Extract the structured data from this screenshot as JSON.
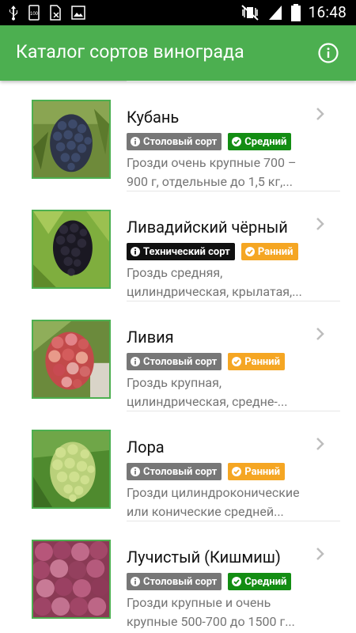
{
  "status_bar": {
    "time": "16:48",
    "left_icons": [
      "usb-icon",
      "storage-100-icon",
      "sim-off-icon",
      "image-icon"
    ],
    "right_icons": [
      "mute-vibrate-icon",
      "signal-icon",
      "battery-icon"
    ]
  },
  "app_bar": {
    "title": "Каталог сортов винограда",
    "background": "#4CAF50",
    "action_icon": "info-icon"
  },
  "items": [
    {
      "title": "Кубань",
      "tag1": "Столовый сорт",
      "tag1_color": "#777777",
      "tag2": "Средний",
      "tag2_color": "#138D13",
      "desc1": "Грозди очень крупные 700 –",
      "desc2": "900 г, отдельные до 1,5 кг,..."
    },
    {
      "title": "Ливадийский чёрный",
      "tag1": "Технический сорт",
      "tag1_color": "#111111",
      "tag2": "Ранний",
      "tag2_color": "#F5A623",
      "desc1": "Гроздь средняя,",
      "desc2": "цилиндрическая, крылатая,..."
    },
    {
      "title": "Ливия",
      "tag1": "Столовый сорт",
      "tag1_color": "#777777",
      "tag2": "Ранний",
      "tag2_color": "#F5A623",
      "desc1": "Гроздь крупная,",
      "desc2": "цилиндрическая, средне-..."
    },
    {
      "title": "Лора",
      "tag1": "Столовый сорт",
      "tag1_color": "#777777",
      "tag2": "Ранний",
      "tag2_color": "#F5A623",
      "desc1": "Грозди цилиндроконические",
      "desc2": "или конические средней..."
    },
    {
      "title": "Лучистый (Кишмиш)",
      "tag1": "Столовый сорт",
      "tag1_color": "#777777",
      "tag2": "Средний",
      "tag2_color": "#138D13",
      "desc1": "Грозди крупные и очень",
      "desc2": "крупные 500-700 до 1500 г..."
    }
  ]
}
